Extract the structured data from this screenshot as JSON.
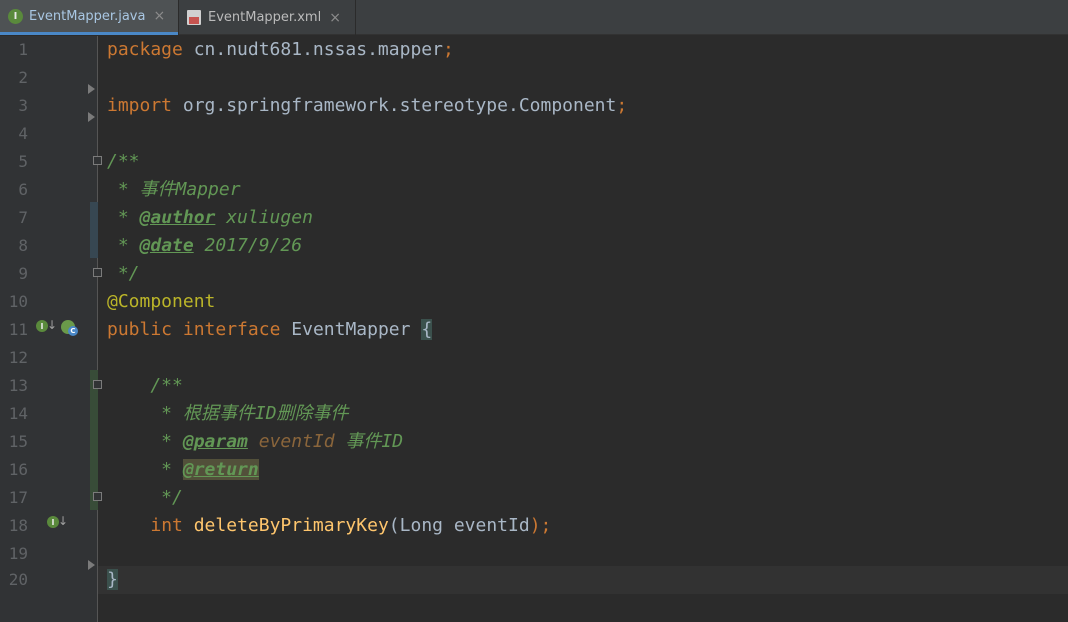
{
  "tabs": [
    {
      "label": "EventMapper.java",
      "icon": "interface-java-icon",
      "active": true
    },
    {
      "label": "EventMapper.xml",
      "icon": "xml-file-icon",
      "active": false
    }
  ],
  "close_glyph": "×",
  "editor": {
    "line_numbers": [
      "1",
      "2",
      "3",
      "4",
      "5",
      "6",
      "7",
      "8",
      "9",
      "10",
      "11",
      "12",
      "13",
      "14",
      "15",
      "16",
      "17",
      "18",
      "19",
      "20"
    ],
    "line1": {
      "kw": "package",
      "rest": "cn.nudt681.nssas.mapper",
      "end": ";"
    },
    "line3": {
      "kw": "import",
      "pkg": "org.springframework.stereotype.",
      "cls": "Component",
      "end": ";"
    },
    "line5": "/**",
    "line6": " * 事件Mapper",
    "line7": {
      "star": " * ",
      "tag": "@author",
      "text": " xuliugen"
    },
    "line8": {
      "star": " * ",
      "tag": "@date",
      "text": " 2017/9/26"
    },
    "line9": " */",
    "line10": "@Component",
    "line11": {
      "kw1": "public",
      "kw2": "interface",
      "name": "EventMapper",
      "brace": "{"
    },
    "line13": "    /**",
    "line14": "     * 根据事件ID删除事件",
    "line15": {
      "star": "     * ",
      "tag": "@param",
      "pname": " eventId",
      "text": " 事件ID"
    },
    "line16": {
      "star": "     * ",
      "tag": "@return"
    },
    "line17": "     */",
    "line18": {
      "indent": "    ",
      "kw": "int",
      "fn": "deleteByPrimaryKey",
      "open": "(",
      "type": "Long",
      "arg": " eventId",
      "close": ");"
    },
    "line20": "}"
  },
  "colors": {
    "keyword": "#cc7832",
    "doc": "#629755",
    "method": "#ffc66d",
    "annotation": "#bbb529"
  }
}
